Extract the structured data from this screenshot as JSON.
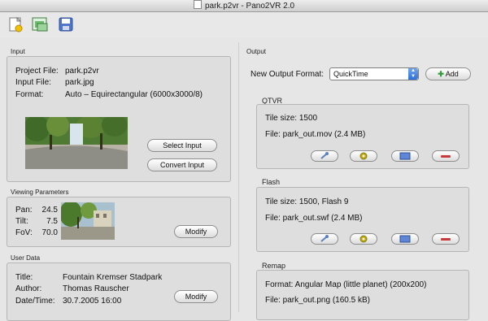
{
  "window": {
    "title": "park.p2vr - Pano2VR 2.0"
  },
  "toolbar": {
    "icons": [
      "new-project-icon",
      "open-project-icon",
      "save-project-icon"
    ]
  },
  "input": {
    "section_label": "Input",
    "project_file_label": "Project File:",
    "project_file_value": "park.p2vr",
    "input_file_label": "Input File:",
    "input_file_value": "park.jpg",
    "format_label": "Format:",
    "format_value": "Auto – Equirectangular (6000x3000/8)",
    "select_button": "Select Input",
    "convert_button": "Convert Input"
  },
  "viewing": {
    "section_label": "Viewing Parameters",
    "pan_label": "Pan:",
    "pan_value": "24.5",
    "tilt_label": "Tilt:",
    "tilt_value": "7.5",
    "fov_label": "FoV:",
    "fov_value": "70.0",
    "modify_button": "Modify"
  },
  "userdata": {
    "section_label": "User Data",
    "title_label": "Title:",
    "title_value": "Fountain Kremser Stadpark",
    "author_label": "Author:",
    "author_value": "Thomas Rauscher",
    "datetime_label": "Date/Time:",
    "datetime_value": "30.7.2005 16:00",
    "modify_button": "Modify"
  },
  "output": {
    "section_label": "Output",
    "format_label": "New Output Format:",
    "format_value": "QuickTime",
    "add_button": "Add",
    "qtvr": {
      "label": "QTVR",
      "tile": "Tile size: 1500",
      "file": "File: park_out.mov (2.4 MB)"
    },
    "flash": {
      "label": "Flash",
      "tile": "Tile size: 1500, Flash 9",
      "file": "File: park_out.swf (2.4 MB)"
    },
    "remap": {
      "label": "Remap",
      "format": "Format: Angular Map (little planet) (200x200)",
      "file": "File: park_out.png (160.5 kB)"
    }
  },
  "colors": {
    "accent_blue": "#2f6fd6",
    "delete_red": "#c83a3a",
    "add_green": "#2e9a3a"
  }
}
